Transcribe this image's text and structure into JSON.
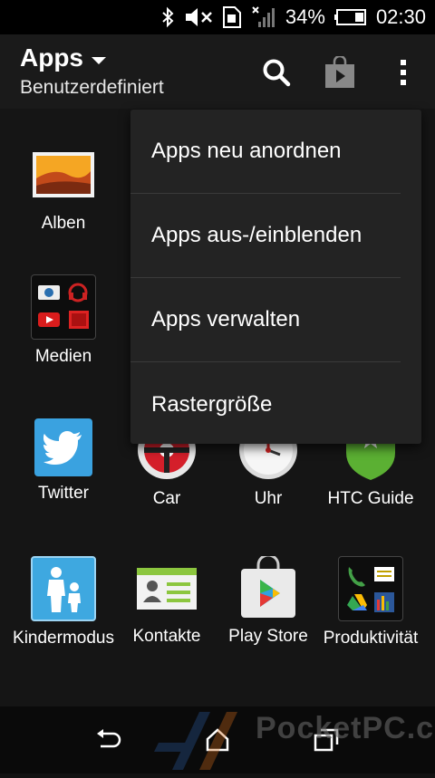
{
  "status": {
    "battery": "34%",
    "time": "02:30"
  },
  "appbar": {
    "title": "Apps",
    "subtitle": "Benutzerdefiniert"
  },
  "menu": {
    "items": [
      "Apps neu anordnen",
      "Apps aus-/einblenden",
      "Apps verwalten",
      "Rastergröße"
    ]
  },
  "apps": {
    "alben": "Alben",
    "medien": "Medien",
    "twitter": "Twitter",
    "car": "Car",
    "uhr": "Uhr",
    "htcguide": "HTC Guide",
    "kindermodus": "Kindermodus",
    "kontakte": "Kontakte",
    "playstore": "Play Store",
    "produktivitaet": "Produktivität"
  },
  "watermark": {
    "text": "PocketPC.ch"
  },
  "colors": {
    "twitter": "#3aa2e0",
    "kinder": "#3ea8e0",
    "htcguide": "#5bb033",
    "car": "#d41f2a",
    "statusbar": "#000000",
    "menu": "#232323"
  }
}
